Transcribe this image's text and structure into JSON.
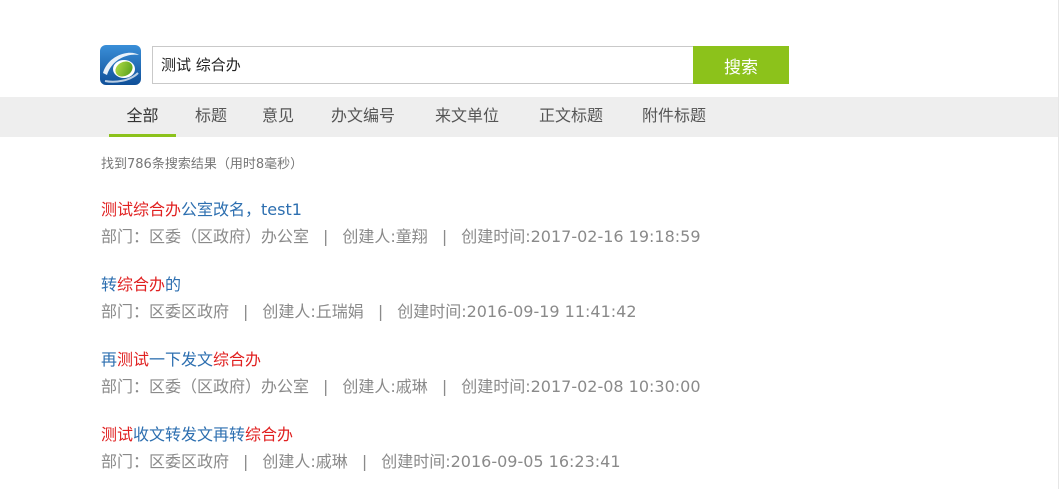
{
  "search": {
    "query": "测试 综合办",
    "clear_icon": "×",
    "button_label": "搜索"
  },
  "tabs": [
    {
      "label": "全部",
      "active": true
    },
    {
      "label": "标题"
    },
    {
      "label": "意见"
    },
    {
      "label": "办文编号"
    },
    {
      "label": "来文单位"
    },
    {
      "label": "正文标题"
    },
    {
      "label": "附件标题"
    }
  ],
  "summary": "找到786条搜索结果（用时8毫秒）",
  "results": [
    {
      "title_parts": [
        {
          "text": "测试综合办",
          "highlight": true
        },
        {
          "text": "公室改名，test1",
          "highlight": false
        }
      ],
      "department": "部门：区委（区政府）办公室",
      "creator": "创建人:童翔",
      "created": "创建时间:2017-02-16 19:18:59"
    },
    {
      "title_parts": [
        {
          "text": "转",
          "highlight": false
        },
        {
          "text": "综合办",
          "highlight": true
        },
        {
          "text": "的",
          "highlight": false
        }
      ],
      "department": "部门：区委区政府",
      "creator": "创建人:丘瑞娟",
      "created": "创建时间:2016-09-19 11:41:42"
    },
    {
      "title_parts": [
        {
          "text": "再",
          "highlight": false
        },
        {
          "text": "测试",
          "highlight": true
        },
        {
          "text": "一下发文",
          "highlight": false
        },
        {
          "text": "综合办",
          "highlight": true
        }
      ],
      "department": "部门：区委（区政府）办公室",
      "creator": "创建人:戚琳",
      "created": "创建时间:2017-02-08 10:30:00"
    },
    {
      "title_parts": [
        {
          "text": "测试",
          "highlight": true
        },
        {
          "text": "收文转发文再转",
          "highlight": false
        },
        {
          "text": "综合办",
          "highlight": true
        }
      ],
      "department": "部门：区委区政府",
      "creator": "创建人:戚琳",
      "created": "创建时间:2016-09-05 16:23:41"
    }
  ],
  "separator": "|",
  "colors": {
    "accent": "#8cc21b",
    "highlight": "#e02020",
    "link": "#2d6fb0",
    "meta": "#8a8a8a"
  }
}
